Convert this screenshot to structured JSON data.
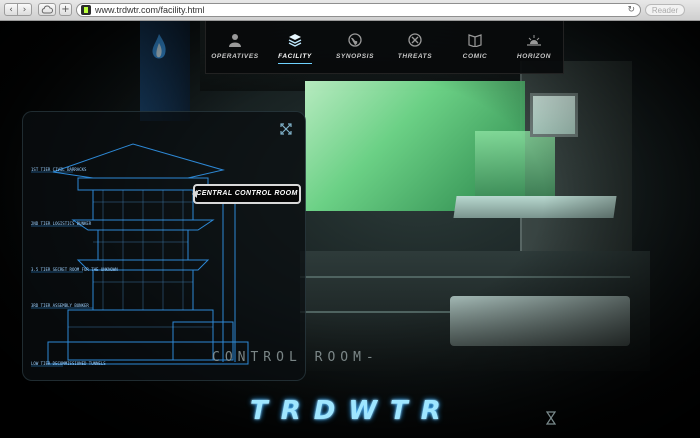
{
  "browser": {
    "url": "www.trdwtr.com/facility.html",
    "reader_label": "Reader",
    "back_icon": "chevron-left-icon",
    "forward_icon": "chevron-right-icon",
    "reload_icon": "reload-icon"
  },
  "nav": {
    "items": [
      {
        "label": "OPERATIVES",
        "icon": "person-icon",
        "active": false
      },
      {
        "label": "FACILITY",
        "icon": "layers-icon",
        "active": true
      },
      {
        "label": "SYNOPSIS",
        "icon": "globe-icon",
        "active": false
      },
      {
        "label": "THREATS",
        "icon": "target-icon",
        "active": false
      },
      {
        "label": "COMIC",
        "icon": "book-icon",
        "active": false
      },
      {
        "label": "HORIZON",
        "icon": "sunrise-icon",
        "active": false
      }
    ]
  },
  "blueprint": {
    "tooltip": "CENTRAL CONTROL ROOM",
    "floor_labels": [
      "1ST TIER CIVIL BARRACKS",
      "2ND TIER LOGISTICS BUNKER",
      "3.5 TIER SECRET ROOM FOR THE UNKNOWN",
      "3RD TIER ASSEMBLY BUNKER",
      "LOW TIER DECOMMISSIONED TUNNELS"
    ]
  },
  "room_caption": "CONTROL ROOM-",
  "logo": "TRDWTR",
  "colors": {
    "accent": "#6fd2ff",
    "blueprint": "#2f8fe0",
    "window_glow": "#6fd98a"
  }
}
